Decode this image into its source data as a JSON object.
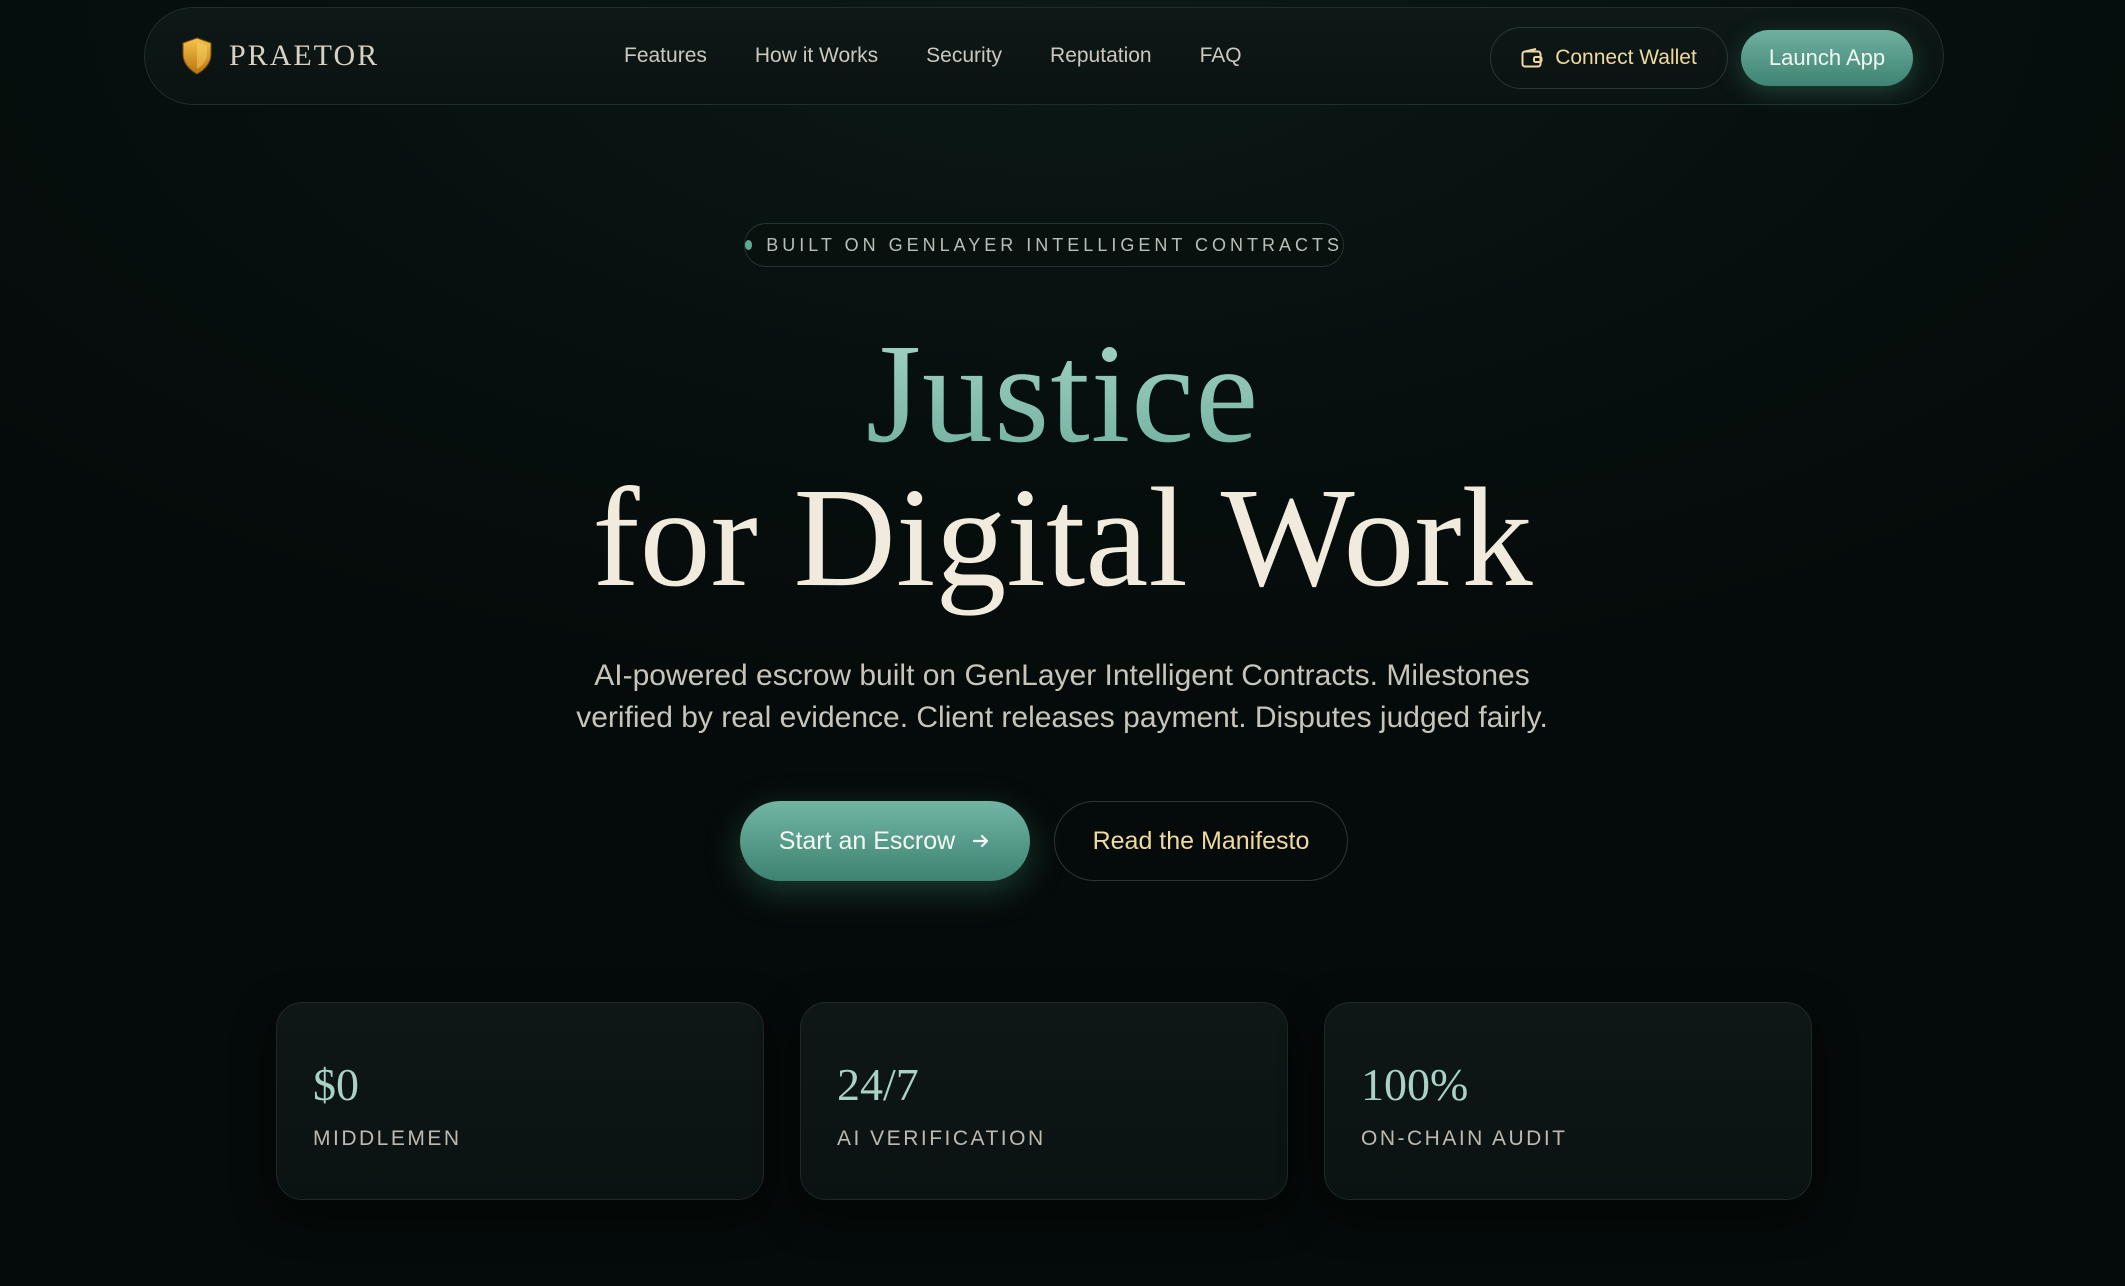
{
  "brand": {
    "name": "PRAETOR",
    "icon": "shield-icon",
    "icon_color": "#e3a526"
  },
  "nav": {
    "links": [
      "Features",
      "How it Works",
      "Security",
      "Reputation",
      "FAQ"
    ],
    "connect_wallet": "Connect Wallet",
    "connect_icon": "wallet-icon",
    "launch_app": "Launch App"
  },
  "badge": {
    "text": "BUILT ON GENLAYER INTELLIGENT CONTRACTS"
  },
  "hero": {
    "line1": "Justice",
    "line2": "for Digital Work",
    "subtitle_line1": "AI-powered escrow built on GenLayer Intelligent Contracts. Milestones",
    "subtitle_line2": "verified by real evidence. Client releases payment. Disputes judged fairly."
  },
  "cta": {
    "primary": "Start an Escrow",
    "primary_icon": "arrow-right-icon",
    "secondary": "Read the Manifesto"
  },
  "stats": [
    {
      "value": "$0",
      "label": "MIDDLEMEN"
    },
    {
      "value": "24/7",
      "label": "AI VERIFICATION"
    },
    {
      "value": "100%",
      "label": "ON-CHAIN AUDIT"
    }
  ],
  "colors": {
    "background": "#060d0c",
    "accent_teal": "#5fa893",
    "accent_gold": "#f0d9a0",
    "text_cream": "#f1ebdd"
  }
}
